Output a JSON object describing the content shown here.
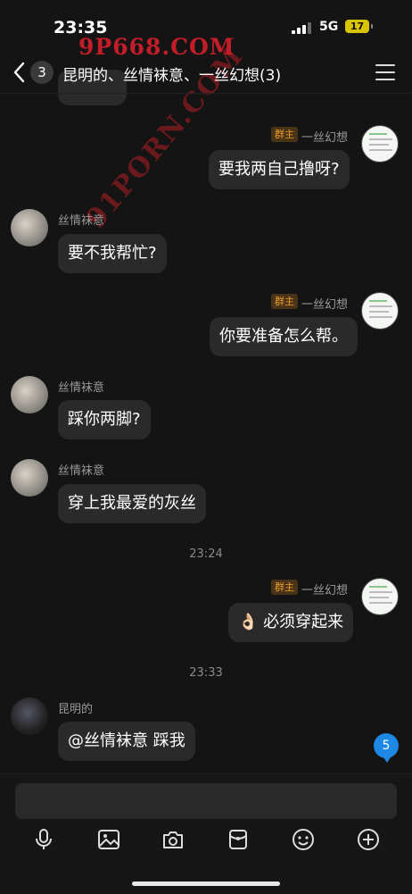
{
  "status": {
    "time": "23:35",
    "network": "5G",
    "battery": "17"
  },
  "watermark": {
    "text": "9P668.COM",
    "diagonal_text": "91PORN.COM"
  },
  "nav": {
    "back_count": "3",
    "title": "昆明的、丝情袜意、一丝幻想(3)"
  },
  "messages": [
    {
      "sender": "一丝幻想",
      "role": "群主",
      "text": "要我两自己撸呀?"
    },
    {
      "sender": "丝情袜意",
      "text": "要不我帮忙?"
    },
    {
      "sender": "一丝幻想",
      "role": "群主",
      "text": "你要准备怎么帮。"
    },
    {
      "sender": "丝情袜意",
      "text": "踩你两脚?"
    },
    {
      "sender": "丝情袜意",
      "text": "穿上我最爱的灰丝"
    },
    {
      "sender": "一丝幻想",
      "role": "群主",
      "text": "👌🏻 必须穿起来"
    },
    {
      "sender": "昆明的",
      "text": "@丝情袜意 踩我"
    }
  ],
  "timestamps": [
    "23:24",
    "23:33"
  ],
  "unread_count": "5",
  "toolbar": [
    "mic-icon",
    "image-icon",
    "camera-icon",
    "red-packet-icon",
    "emoji-icon",
    "plus-icon"
  ]
}
